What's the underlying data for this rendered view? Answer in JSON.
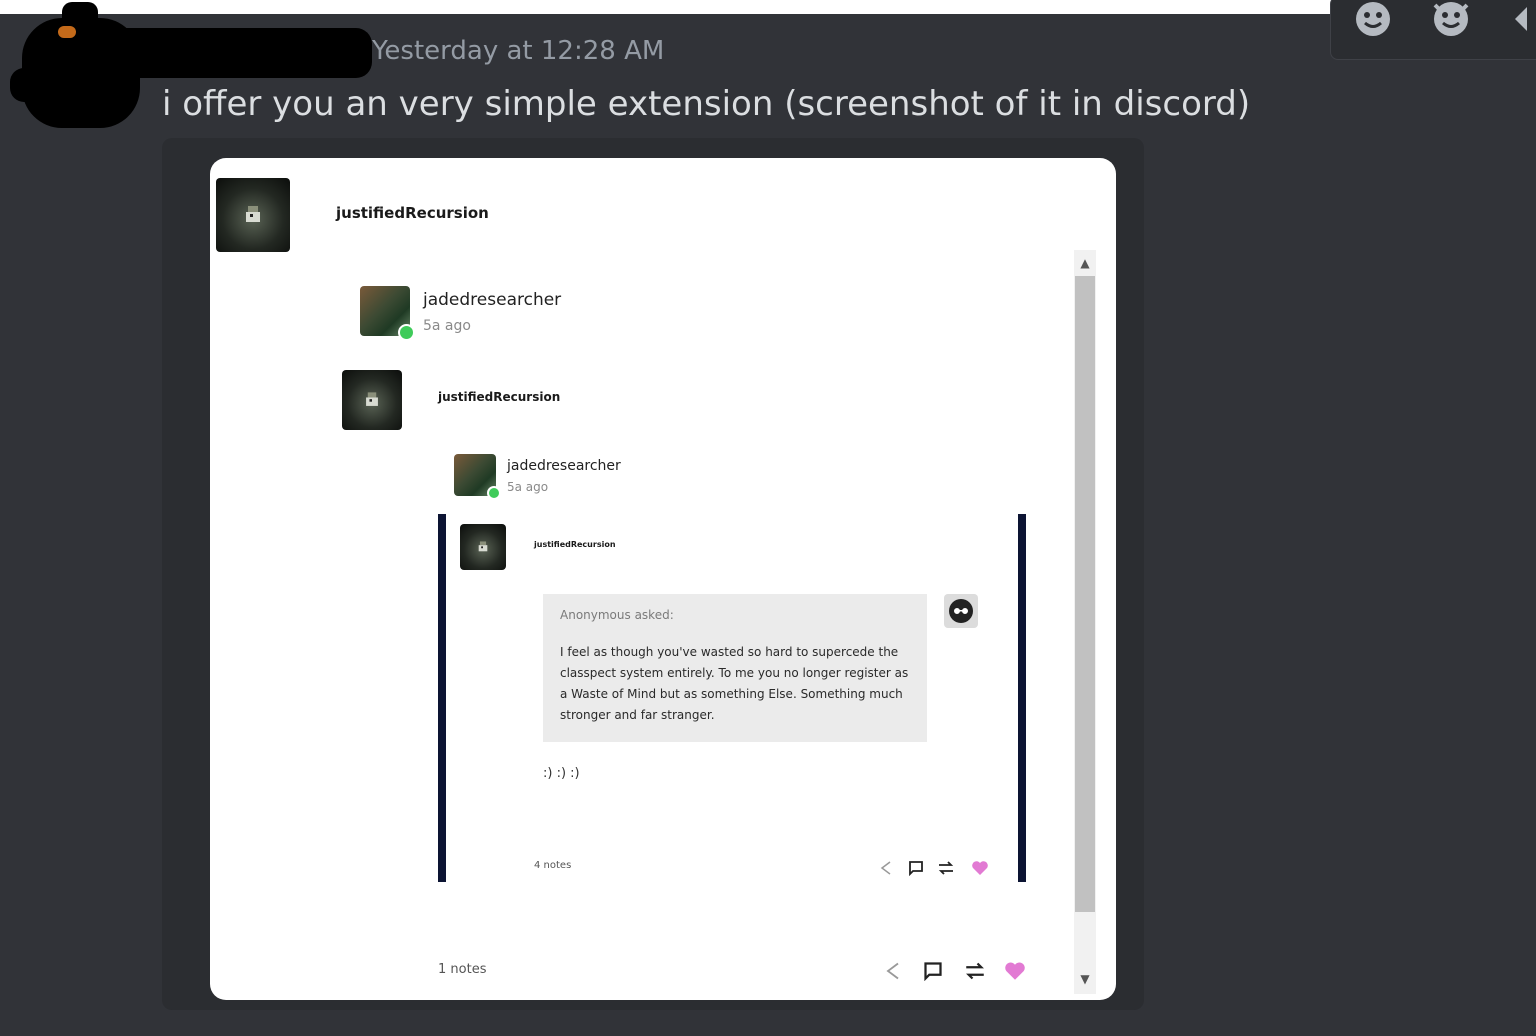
{
  "message": {
    "timestamp": "Yesterday at 12:28 AM",
    "text": "i offer you an very simple extension (screenshot of it in discord)"
  },
  "screenshot": {
    "outer_post": {
      "username": "justifiedRecursion",
      "notes": "1 notes"
    },
    "reblog_1": {
      "username": "jadedresearcher",
      "time": "5a ago"
    },
    "reblog_2": {
      "username": "justifiedRecursion"
    },
    "reblog_3": {
      "username": "jadedresearcher",
      "time": "5a ago"
    },
    "inner_post": {
      "username": "justifiedRecursion",
      "asker": "Anonymous asked:",
      "question": "I feel as though you've wasted so hard to supercede the classpect system entirely. To me you no longer register as a Waste of Mind but as something Else. Something much stronger and far stranger.",
      "reply": ":) :) :)",
      "notes": "4 notes"
    }
  },
  "colors": {
    "discord_bg": "#313338",
    "like": "#e27ad3",
    "reblog_bar": "#0c1433",
    "online_dot": "#3fcb5a"
  }
}
